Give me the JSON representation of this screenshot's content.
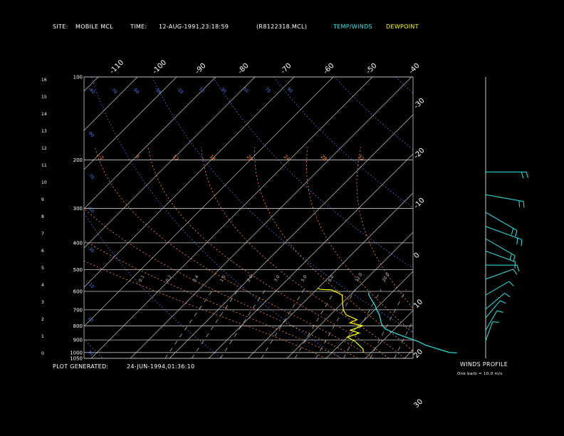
{
  "header": {
    "site_label": "SITE:",
    "site_value": "MOBILE MCL",
    "time_label": "TIME:",
    "time_value": "12-AUG-1991,23:18:59",
    "file": "(R8122318.MCL)",
    "legend_temp": "TEMP/WINDS",
    "legend_dew": "DEWPOINT"
  },
  "footer": {
    "plot_generated_label": "PLOT GENERATED:",
    "plot_generated_value": "24-JUN-1994,01:36:10",
    "winds_title": "WINDS PROFILE",
    "barb_note": "One barb = 10.0 m/s"
  },
  "colors": {
    "temp": "#33e6e6",
    "dewpoint": "#ffff00",
    "isotherm": "#c8c8c8",
    "dry_adiabat": "#5a82ff",
    "moist_adiabat": "#ff8c46",
    "mixing_ratio": "#c8c8c8",
    "grid": "#c8c8c8"
  },
  "chart_data": {
    "type": "line",
    "title": "",
    "xlabel": "",
    "ylabel": "",
    "pressure_levels_mb": [
      100,
      200,
      300,
      400,
      500,
      600,
      700,
      800,
      900,
      1000,
      1050
    ],
    "pressure_labels": [
      "100",
      "200",
      "300",
      "400",
      "500",
      "600",
      "700",
      "800",
      "900",
      "1000",
      "1050"
    ],
    "height_labels_km": [
      "0",
      "1",
      "2",
      "3",
      "4",
      "5",
      "6",
      "7",
      "8",
      "9",
      "10",
      "11",
      "12",
      "13",
      "14",
      "15",
      "16"
    ],
    "isotherm_labels_c": [
      "-110",
      "-100",
      "-90",
      "-80",
      "-70",
      "-60",
      "-50",
      "-40",
      "-30",
      "-20",
      "-10",
      "0",
      "10",
      "20",
      "30"
    ],
    "dry_adiabat_labels": [
      "-90",
      "-70",
      "-50",
      "-30",
      "-10",
      "10",
      "30",
      "50",
      "70",
      "90",
      "110",
      "130",
      "150",
      "170",
      "190",
      "210"
    ],
    "moist_adiabat_labels": [
      "-2",
      "6",
      "12",
      "16",
      "20",
      "24",
      "28",
      "32"
    ],
    "mixing_ratio_labels": [
      "0.1",
      "0.2",
      "0.4",
      "1.0",
      "2.0",
      "3.0",
      "5.0",
      "8.0",
      "12.0",
      "20.0"
    ],
    "series": [
      {
        "name": "TEMP/WINDS",
        "points": [
          {
            "p": 605,
            "t": -6.0
          },
          {
            "p": 615,
            "t": -5.5
          },
          {
            "p": 635,
            "t": -4.0
          },
          {
            "p": 655,
            "t": -2.5
          },
          {
            "p": 675,
            "t": -1.0
          },
          {
            "p": 700,
            "t": 0.5
          },
          {
            "p": 730,
            "t": 2.5
          },
          {
            "p": 760,
            "t": 4.0
          },
          {
            "p": 790,
            "t": 5.5
          },
          {
            "p": 820,
            "t": 7.5
          },
          {
            "p": 850,
            "t": 11.0
          },
          {
            "p": 880,
            "t": 15.0
          },
          {
            "p": 910,
            "t": 19.0
          },
          {
            "p": 940,
            "t": 22.0
          },
          {
            "p": 970,
            "t": 26.0
          },
          {
            "p": 1000,
            "t": 30.0
          },
          {
            "p": 1003,
            "t": 32.0
          }
        ]
      },
      {
        "name": "DEWPOINT",
        "points": [
          {
            "p": 585,
            "t": -20.0
          },
          {
            "p": 590,
            "t": -19.0
          },
          {
            "p": 593,
            "t": -16.0
          },
          {
            "p": 600,
            "t": -15.0
          },
          {
            "p": 605,
            "t": -14.0
          },
          {
            "p": 620,
            "t": -12.0
          },
          {
            "p": 660,
            "t": -10.0
          },
          {
            "p": 700,
            "t": -8.0
          },
          {
            "p": 730,
            "t": -6.0
          },
          {
            "p": 760,
            "t": -2.0
          },
          {
            "p": 780,
            "t": -3.0
          },
          {
            "p": 800,
            "t": 1.0
          },
          {
            "p": 830,
            "t": -1.0
          },
          {
            "p": 850,
            "t": 2.0
          },
          {
            "p": 880,
            "t": 0.0
          },
          {
            "p": 910,
            "t": 3.0
          },
          {
            "p": 940,
            "t": 5.0
          },
          {
            "p": 970,
            "t": 7.0
          },
          {
            "p": 1000,
            "t": 8.0
          }
        ]
      }
    ],
    "winds": [
      {
        "z_km": 1.0,
        "dir_deg": 200,
        "speed_ms": 4
      },
      {
        "z_km": 1.6,
        "dir_deg": 210,
        "speed_ms": 6
      },
      {
        "z_km": 2.3,
        "dir_deg": 220,
        "speed_ms": 6
      },
      {
        "z_km": 2.8,
        "dir_deg": 230,
        "speed_ms": 8
      },
      {
        "z_km": 3.6,
        "dir_deg": 240,
        "speed_ms": 10
      },
      {
        "z_km": 4.5,
        "dir_deg": 250,
        "speed_ms": 12
      },
      {
        "z_km": 5.3,
        "dir_deg": 270,
        "speed_ms": 14
      },
      {
        "z_km": 6.1,
        "dir_deg": 290,
        "speed_ms": 14
      },
      {
        "z_km": 6.8,
        "dir_deg": 300,
        "speed_ms": 16
      },
      {
        "z_km": 7.5,
        "dir_deg": 290,
        "speed_ms": 20
      },
      {
        "z_km": 8.3,
        "dir_deg": 300,
        "speed_ms": 18
      },
      {
        "z_km": 9.3,
        "dir_deg": 280,
        "speed_ms": 20
      },
      {
        "z_km": 10.6,
        "dir_deg": 270,
        "speed_ms": 22
      }
    ]
  }
}
